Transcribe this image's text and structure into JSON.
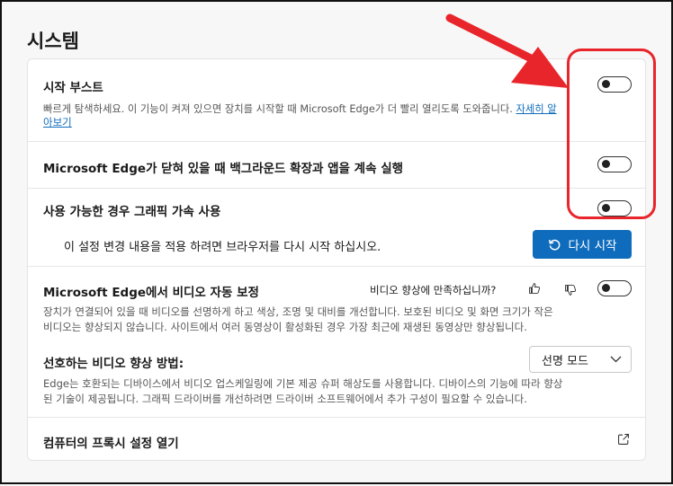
{
  "page_title": "시스템",
  "startup_boost": {
    "label": "시작 부스트",
    "description_line1": "빠르게 탐색하세요. 이 기능이 켜져 있으면 장치를 시작할 때 Microsoft Edge가 더 빨리 열리도록 도와줍니다.",
    "link_part1": "자세히 알",
    "link_part2": "아보기",
    "enabled": false
  },
  "background_extensions": {
    "label": "Microsoft Edge가 닫혀 있을 때 백그라운드 확장과 앱을 계속 실행",
    "enabled": false
  },
  "hardware_acceleration": {
    "label": "사용 가능한 경우 그래픽 가속 사용",
    "enabled": false,
    "restart_message": "이 설정 변경 내용을 적용 하려면 브라우저를 다시 시작 하십시오.",
    "restart_button": "다시 시작"
  },
  "video_enhance": {
    "label": "Microsoft Edge에서 비디오 자동 보정",
    "feedback_question": "비디오 향상에 만족하십니까?",
    "enabled": false,
    "description_line1": "장치가 연결되어 있을 때 비디오를 선명하게 하고 색상, 조명 및 대비를 개선합니다. 보호된 비디오 및 화면 크기가 작은",
    "description_line2": "비디오는 향상되지 않습니다. 사이트에서 여러 동영상이 활성화된 경우 가장 최근에 재생된 동영상만 향상됩니다."
  },
  "video_method": {
    "label": "선호하는 비디오 향상 방법:",
    "selected": "선명 모드",
    "description_line1": "Edge는 호환되는 디바이스에서 비디오 업스케일링에 기본 제공 슈퍼 해상도를 사용합니다. 디바이스의 기능에 따라 향상",
    "description_line2": "된 기술이 제공됩니다. 그래픽 드라이버를 개선하려면 드라이버 소프트웨어에서 추가 구성이 필요할 수 있습니다."
  },
  "proxy": {
    "label": "컴퓨터의 프록시 설정 열기"
  },
  "colors": {
    "accent": "#0f6cbd",
    "annotation": "#e8252b"
  }
}
